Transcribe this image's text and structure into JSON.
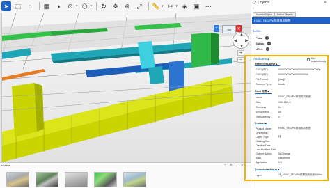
{
  "toolbar": {
    "icons": [
      "select-arrow-icon",
      "select-window-icon",
      "lasso-icon",
      "section-box-icon",
      "hide-icon",
      "isolate-icon",
      "cube-icon",
      "orbit-icon",
      "pan-icon",
      "zoom-window-icon",
      "fit-view-icon",
      "measure-icon",
      "cut-plane-icon",
      "color-icon",
      "camera-icon",
      "more-icon"
    ]
  },
  "viewport": {
    "viewcube_label": "Top",
    "badges": [
      {
        "color": "#2b7bd6",
        "glyph": "+"
      },
      {
        "color": "#e03030",
        "glyph": "✕"
      }
    ]
  },
  "bottom": {
    "label": "n views",
    "add_label": "+"
  },
  "panel": {
    "title": "Objects",
    "zoom_button": "Zoom to Object",
    "select_button": "Select Objects",
    "selected_object": "HVAC_SED/P#/排烟排风系统",
    "links_title": "Links",
    "links": [
      "Files",
      "Suites",
      "URLs"
    ],
    "attributes_title": "Attributes",
    "sort_label": "Sort alphabetically",
    "sections": [
      {
        "title": "ReferenceObject",
        "rows": [
          {
            "k": "GUID (IFC)",
            "v": "0000000000000000000000000000000"
          },
          {
            "k": "GUID (IFC)",
            "v": "0000000000000000000000"
          },
          {
            "k": "File Format",
            "v": "[dwg]3"
          },
          {
            "k": "Common Type",
            "v": "Invalid"
          }
        ]
      },
      {
        "title": "Revit 材质",
        "rows": [
          {
            "k": "Name",
            "v": "HVAC_SED/P#/排烟排风系统"
          },
          {
            "k": "Color",
            "v": "150, 150, 0"
          },
          {
            "k": "Shininess",
            "v": "64"
          },
          {
            "k": "Smoothness",
            "v": "50"
          },
          {
            "k": "Transparency",
            "v": "0"
          }
        ]
      },
      {
        "title": "Product",
        "rows": [
          {
            "k": "Product Name",
            "v": "HVAC_SED/P#/排烟排风系统"
          },
          {
            "k": "Description",
            "v": ""
          },
          {
            "k": "Object Type",
            "v": "线"
          },
          {
            "k": "Drawing Size",
            "v": ""
          },
          {
            "k": "Creation Date",
            "v": ""
          },
          {
            "k": "Last Modified Date",
            "v": ""
          },
          {
            "k": "Change Action",
            "v": "NoChange"
          },
          {
            "k": "State",
            "v": "Undefined"
          },
          {
            "k": "Application",
            "v": "1.0"
          }
        ]
      },
      {
        "title": "PresentationLayer",
        "rows": [
          {
            "k": "Layer",
            "v": "1F_HVAC_SED/P#/排烟排风系统/0.00m"
          }
        ]
      }
    ]
  }
}
